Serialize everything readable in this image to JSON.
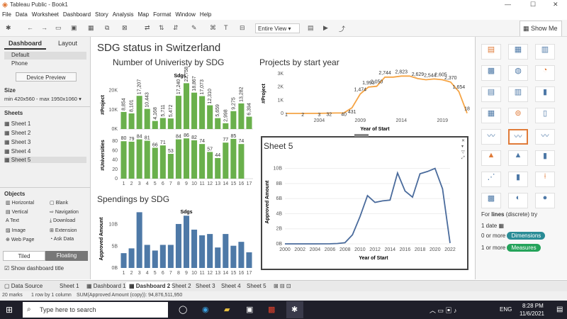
{
  "window": {
    "title": "Tableau Public - Book1"
  },
  "menu": [
    "File",
    "Data",
    "Worksheet",
    "Dashboard",
    "Story",
    "Analysis",
    "Map",
    "Format",
    "Window",
    "Help"
  ],
  "toolbar": {
    "view_select": "Entire View",
    "show_me": "Show Me"
  },
  "left": {
    "tabs": [
      "Dashboard",
      "Layout"
    ],
    "devices": [
      "Default",
      "Phone"
    ],
    "device_preview": "Device Preview",
    "size_label": "Size",
    "size_value": "min 420x560 - max 1950x1060",
    "sheets_label": "Sheets",
    "sheets": [
      "Sheet 1",
      "Sheet 2",
      "Sheet 3",
      "Sheet 4",
      "Sheet 5"
    ],
    "objects_label": "Objects",
    "objects": [
      "Horizontal",
      "Blank",
      "Vertical",
      "Navigation",
      "Text",
      "Download",
      "Image",
      "Extension",
      "Web Page",
      "Ask Data"
    ],
    "tiled": "Tiled",
    "floating": "Floating",
    "show_title": "Show dashboard title"
  },
  "dashboard": {
    "title": "SDG status in Switzerland",
    "universities_title": "Number of Univeristy by SDG",
    "projects_title": "Projects by start year",
    "spendings_title": "Spendings by SDG",
    "sheet5_title": "Sheet 5"
  },
  "chart_data": [
    {
      "type": "bar",
      "title": "Number of Univeristy by SDG",
      "xlabel": "Sdgs",
      "categories": [
        "1",
        "2",
        "3",
        "4",
        "5",
        "6",
        "7",
        "8",
        "9",
        "10",
        "11",
        "12",
        "13",
        "14",
        "15",
        "16",
        "17"
      ],
      "series": [
        {
          "name": "#Project",
          "values": [
            8854,
            8101,
            17207,
            10443,
            4168,
            5711,
            5472,
            17240,
            23758,
            18867,
            17073,
            12310,
            5659,
            2998,
            9275,
            13282,
            6394
          ],
          "labels": [
            "8,854",
            "8,101",
            "17,207",
            "10,443",
            "4,168",
            "5,711",
            "5,472",
            "17,240",
            "23,758",
            "18,867",
            "17,073",
            "12,310",
            "5,659",
            "2,998",
            "9,275",
            "13,282",
            "6,394"
          ],
          "ylim": [
            0,
            25000
          ],
          "ticks": [
            "0K",
            "10K",
            "20K"
          ]
        },
        {
          "name": "#Universities",
          "values": [
            80,
            79,
            84,
            81,
            66,
            71,
            53,
            84,
            86,
            82,
            74,
            57,
            44,
            77,
            85,
            74
          ],
          "labels": [
            "80",
            "79",
            "84",
            "81",
            "66",
            "71",
            "53",
            "84",
            "86",
            "82",
            "74",
            "57",
            "44",
            "77",
            "85",
            "74"
          ],
          "ylim": [
            0,
            100
          ],
          "ticks": [
            "0",
            "20",
            "40",
            "60",
            "80"
          ]
        }
      ],
      "univ_full": [
        80,
        79,
        84,
        81,
        66,
        71,
        53,
        84,
        86,
        82,
        74,
        57,
        44,
        77,
        85,
        74
      ]
    },
    {
      "type": "line",
      "title": "Projects by start year",
      "xlabel": "Year of Start",
      "ylabel": "#Project",
      "x": [
        2000,
        2002,
        2004,
        2006,
        2007,
        2008,
        2009,
        2010,
        2011,
        2012,
        2013,
        2014,
        2015,
        2016,
        2017,
        2018,
        2019,
        2020,
        2021,
        2022
      ],
      "y": [
        1,
        2,
        3,
        32,
        40,
        431,
        1474,
        1993,
        2050,
        2744,
        2744,
        2823,
        2823,
        2629,
        2544,
        2605,
        2544,
        2370,
        1654,
        18
      ],
      "point_labels": [
        "1",
        "2",
        "3",
        "32",
        "40",
        "431",
        "1,474",
        "1,993",
        "2,050",
        "2,744",
        "2,823",
        "2,629",
        "2,544",
        "2,605",
        "2,370",
        "1,654",
        "18"
      ],
      "ylim": [
        0,
        3000
      ],
      "yticks": [
        "1K",
        "2K",
        "3K"
      ],
      "xticks": [
        "2004",
        "2009",
        "2014",
        "2019"
      ]
    },
    {
      "type": "bar",
      "title": "Spendings by SDG",
      "xlabel": "Sdgs",
      "ylabel": "Approved Amount",
      "categories": [
        "1",
        "2",
        "3",
        "4",
        "5",
        "6",
        "7",
        "8",
        "9",
        "10",
        "11",
        "12",
        "13",
        "14",
        "15",
        "16",
        "17"
      ],
      "values": [
        3.4,
        4.5,
        12.8,
        5.3,
        4.0,
        5.3,
        5.3,
        10.1,
        12.0,
        8.8,
        7.5,
        7.8,
        4.7,
        7.8,
        5.1,
        6.0,
        3.6
      ],
      "ylim": [
        0,
        14
      ],
      "yticks": [
        "0B",
        "5B",
        "10B"
      ]
    },
    {
      "type": "line",
      "title": "Sheet 5",
      "xlabel": "Year of Start",
      "ylabel": "Approved Amount",
      "x": [
        2000,
        2002,
        2004,
        2006,
        2007,
        2008,
        2009,
        2010,
        2011,
        2012,
        2013,
        2014,
        2015,
        2016,
        2017,
        2018,
        2019,
        2020,
        2021,
        2022
      ],
      "y": [
        0,
        0,
        0,
        0.01,
        0.05,
        0.15,
        1.2,
        3.6,
        6.4,
        5.5,
        5.7,
        5.8,
        9.4,
        7.0,
        6.2,
        9.3,
        9.6,
        10.0,
        7.3,
        0.1
      ],
      "ylim": [
        0,
        11
      ],
      "yticks": [
        "0B",
        "2B",
        "4B",
        "6B",
        "8B",
        "10B"
      ],
      "xticks": [
        "2000",
        "2002",
        "2004",
        "2006",
        "2008",
        "2010",
        "2012",
        "2014",
        "2016",
        "2018",
        "2020",
        "2022"
      ]
    }
  ],
  "right": {
    "hint_prefix": "For",
    "hint_bold": "lines",
    "hint_suffix": "(discrete) try",
    "line1": "1 date",
    "line2_prefix": "0 or more",
    "dimensions": "Dimensions",
    "line3_prefix": "1 or more",
    "measures": "Measures"
  },
  "tabs": [
    "Data Source",
    "Sheet 1",
    "Dashboard 1",
    "Dashboard 2",
    "Sheet 2",
    "Sheet 3",
    "Sheet 4",
    "Sheet 5"
  ],
  "status": {
    "marks": "20 marks",
    "rows": "1 row by 1 column",
    "sum": "SUM(Approved Amount (copy)): 94,876,511,950"
  },
  "taskbar": {
    "search_placeholder": "Type here to search",
    "lang": "ENG",
    "time": "8:28 PM",
    "date": "11/6/2021"
  },
  "colors": {
    "green": "#6ab04c",
    "orange": "#f5a445",
    "blue": "#4e79a7",
    "sheet5_line": "#4a6b9c"
  }
}
